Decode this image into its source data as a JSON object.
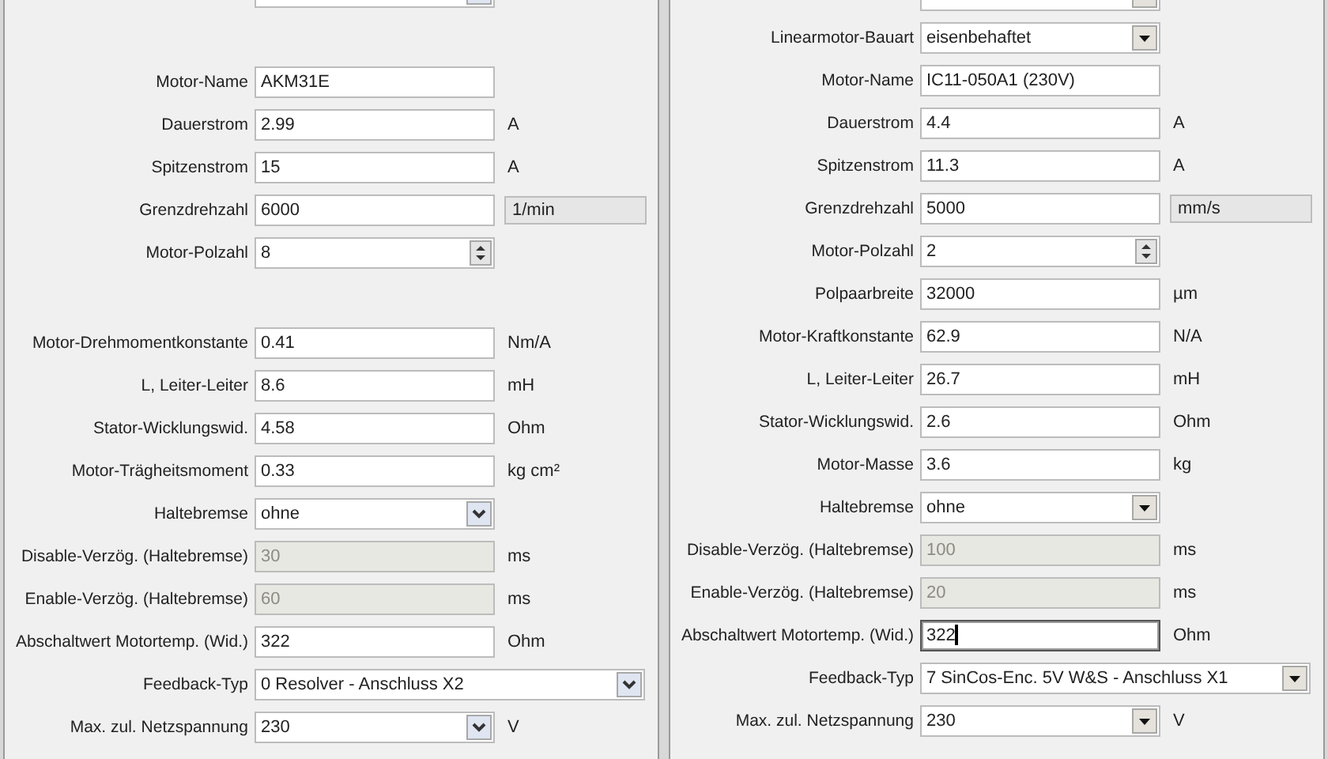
{
  "panels": [
    {
      "sections": [
        [
          {
            "kind": "select",
            "disabled": false
          }
        ],
        [
          {
            "kind": "text",
            "label": "Motor-Name",
            "value": "AKM31E",
            "disabled": false,
            "focused": false
          },
          {
            "kind": "text",
            "label": "Dauerstrom",
            "value": "2.99",
            "unit": "A",
            "disabled": false,
            "focused": false
          },
          {
            "kind": "text",
            "label": "Spitzenstrom",
            "value": "15",
            "unit": "A",
            "disabled": false,
            "focused": false
          },
          {
            "kind": "text",
            "label": "Grenzdrehzahl",
            "value": "6000",
            "unit_box": "1/min",
            "disabled": false,
            "focused": false
          },
          {
            "kind": "spin",
            "label": "Motor-Polzahl",
            "value": "8",
            "disabled": false
          }
        ],
        [
          {
            "kind": "text",
            "label": "Motor-Drehmomentkonstante",
            "value": "0.41",
            "unit": "Nm/A",
            "disabled": false,
            "focused": false
          },
          {
            "kind": "text",
            "label": "L, Leiter-Leiter",
            "value": "8.6",
            "unit": "mH",
            "disabled": false,
            "focused": false
          },
          {
            "kind": "text",
            "label": "Stator-Wicklungswid.",
            "value": "4.58",
            "unit": "Ohm",
            "disabled": false,
            "focused": false
          },
          {
            "kind": "text",
            "label": "Motor-Trägheitsmoment",
            "value": "0.33",
            "unit": "kg cm²",
            "disabled": false,
            "focused": false
          },
          {
            "kind": "select",
            "label": "Haltebremse",
            "value": "ohne",
            "disabled": false
          },
          {
            "kind": "text",
            "label": "Disable-Verzög. (Haltebremse)",
            "value": "30",
            "unit": "ms",
            "disabled": true,
            "focused": false
          },
          {
            "kind": "text",
            "label": "Enable-Verzög. (Haltebremse)",
            "value": "60",
            "unit": "ms",
            "disabled": true,
            "focused": false
          },
          {
            "kind": "text",
            "label": "Abschaltwert Motortemp. (Wid.)",
            "value": "322",
            "unit": "Ohm",
            "disabled": false,
            "focused": false
          },
          {
            "kind": "wide-select",
            "label": "Feedback-Typ",
            "value": "0 Resolver - Anschluss X2",
            "disabled": false
          },
          {
            "kind": "select",
            "label": "Max. zul. Netzspannung",
            "value": "230",
            "unit": "V",
            "disabled": false
          }
        ]
      ]
    },
    {
      "sections": [
        [
          {
            "kind": "select",
            "disabled": false
          },
          {
            "kind": "select",
            "label": "Linearmotor-Bauart",
            "value": "eisenbehaftet",
            "disabled": false
          },
          {
            "kind": "text",
            "label": "Motor-Name",
            "value": "IC11-050A1 (230V)",
            "disabled": false,
            "focused": false
          },
          {
            "kind": "text",
            "label": "Dauerstrom",
            "value": "4.4",
            "unit": "A",
            "disabled": false,
            "focused": false
          },
          {
            "kind": "text",
            "label": "Spitzenstrom",
            "value": "11.3",
            "unit": "A",
            "disabled": false,
            "focused": false
          },
          {
            "kind": "text",
            "label": "Grenzdrehzahl",
            "value": "5000",
            "unit_box": "mm/s",
            "disabled": false,
            "focused": false
          },
          {
            "kind": "spin",
            "label": "Motor-Polzahl",
            "value": "2",
            "disabled": false
          },
          {
            "kind": "text",
            "label": "Polpaarbreite",
            "value": "32000",
            "unit": "µm",
            "disabled": false,
            "focused": false
          },
          {
            "kind": "text",
            "label": "Motor-Kraftkonstante",
            "value": "62.9",
            "unit": "N/A",
            "disabled": false,
            "focused": false
          },
          {
            "kind": "text",
            "label": "L, Leiter-Leiter",
            "value": "26.7",
            "unit": "mH",
            "disabled": false,
            "focused": false
          },
          {
            "kind": "text",
            "label": "Stator-Wicklungswid.",
            "value": "2.6",
            "unit": "Ohm",
            "disabled": false,
            "focused": false
          },
          {
            "kind": "text",
            "label": "Motor-Masse",
            "value": "3.6",
            "unit": "kg",
            "disabled": false,
            "focused": false
          },
          {
            "kind": "select",
            "label": "Haltebremse",
            "value": "ohne",
            "disabled": false
          },
          {
            "kind": "text",
            "label": "Disable-Verzög. (Haltebremse)",
            "value": "100",
            "unit": "ms",
            "disabled": true,
            "focused": false
          },
          {
            "kind": "text",
            "label": "Enable-Verzög. (Haltebremse)",
            "value": "20",
            "unit": "ms",
            "disabled": true,
            "focused": false
          },
          {
            "kind": "text",
            "label": "Abschaltwert Motortemp. (Wid.)",
            "value": "322",
            "unit": "Ohm",
            "disabled": false,
            "focused": true
          },
          {
            "kind": "wide-select",
            "label": "Feedback-Typ",
            "value": "7 SinCos-Enc. 5V W&S - Anschluss X1",
            "disabled": false
          },
          {
            "kind": "select",
            "label": "Max. zul. Netzspannung",
            "value": "230",
            "unit": "V",
            "disabled": false
          }
        ]
      ]
    }
  ]
}
